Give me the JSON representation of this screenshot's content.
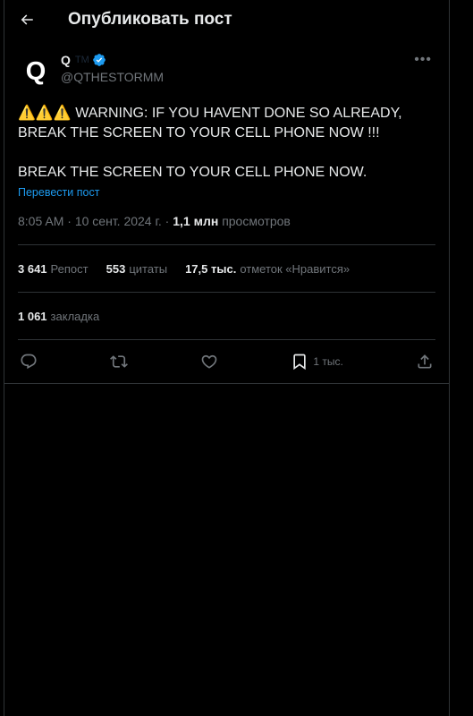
{
  "header": {
    "title": "Опубликовать пост"
  },
  "author": {
    "avatar_letter": "Q",
    "display_name": "Q",
    "tm": "TM",
    "handle": "@QTHESTORMM"
  },
  "post": {
    "paragraph1": "⚠️⚠️⚠️ WARNING: IF YOU HAVENT DONE SO ALREADY, BREAK THE SCREEN TO YOUR CELL PHONE NOW !!!",
    "paragraph2": "BREAK THE SCREEN TO YOUR CELL PHONE NOW.",
    "translate_label": "Перевести пост",
    "time": "8:05 AM",
    "date": "10 сент. 2024 г.",
    "views_count": "1,1 млн",
    "views_label": "просмотров"
  },
  "stats": {
    "reposts_count": "3 641",
    "reposts_label": "Репост",
    "quotes_count": "553",
    "quotes_label": "цитаты",
    "likes_count": "17,5 тыс.",
    "likes_label": "отметок «Нравится»",
    "bookmarks_count": "1 061",
    "bookmarks_label": "закладка"
  },
  "actions": {
    "bookmark_count": "1 тыс."
  },
  "colors": {
    "background": "#000000",
    "text": "#e7e9ea",
    "muted": "#71767b",
    "accent": "#1d9bf0",
    "border": "#2f3336"
  }
}
